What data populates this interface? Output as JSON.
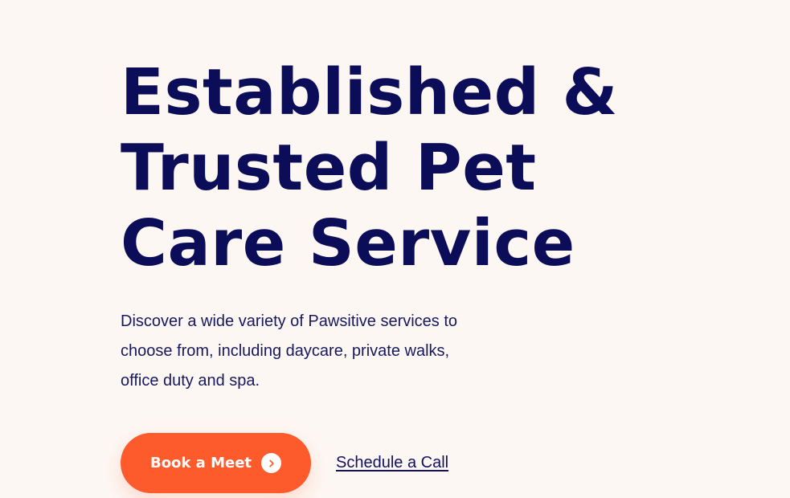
{
  "hero": {
    "headline_lines": [
      "Established &",
      "Trusted Pet",
      "Care Service"
    ],
    "description_lines": [
      "Discover a wide variety of Pawsitive services to",
      "choose from, including daycare, private walks,",
      "office duty and spa."
    ],
    "primary_cta": {
      "label": "Book a Meet",
      "icon": "chevron-right-icon"
    },
    "secondary_cta": {
      "label": "Schedule a Call"
    }
  },
  "colors": {
    "background": "#fdf7f3",
    "headline": "#0c0d59",
    "body_text": "#17195e",
    "accent": "#fe5b2c",
    "button_text": "#ffffff"
  }
}
